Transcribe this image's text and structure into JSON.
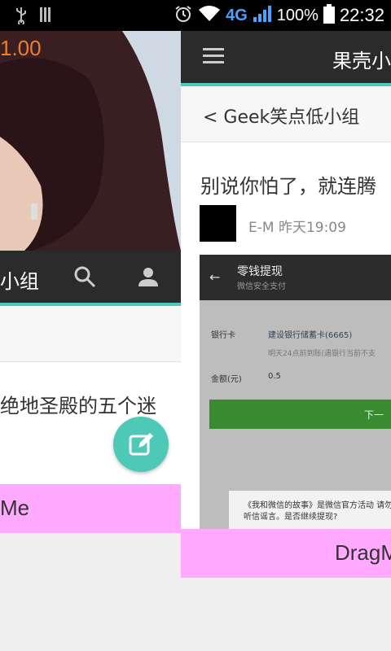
{
  "status_bar": {
    "network": "4G",
    "battery": "100%",
    "time": "22:32",
    "icons": [
      "usb-icon",
      "sim-icon",
      "alarm-icon",
      "wifi-icon",
      "signal-icon",
      "battery-icon"
    ]
  },
  "left_panel": {
    "hero_price": "1.00",
    "toolbar_title": "小组",
    "article_title": "绝地圣殿的五个迷",
    "drag_label": "Me"
  },
  "right_panel": {
    "toolbar_title": "果壳小",
    "breadcrumb": "< Geek笑点低小组",
    "post_title": "别说你怕了，就连腾",
    "author": "E-M",
    "time": "昨天19:09",
    "screenshot": {
      "title": "零钱提现",
      "subtitle": "微信安全支付",
      "bank_label": "银行卡",
      "bank_value": "建设银行储蓄卡(6665)",
      "hint": "明天24点前到账(遇银行当前不支",
      "amount_label": "金额(元)",
      "amount_value": "0.5",
      "button": "下一",
      "dialog": "《我和微信的故事》是微信官方活动 请勿听信谣言。是否继续提现?"
    },
    "drag_label": "DragM"
  },
  "colors": {
    "accent": "#4fc9b7",
    "toolbar": "#2b2b2b",
    "drag_bg": "#ffaaff",
    "price": "#f07c2c"
  }
}
